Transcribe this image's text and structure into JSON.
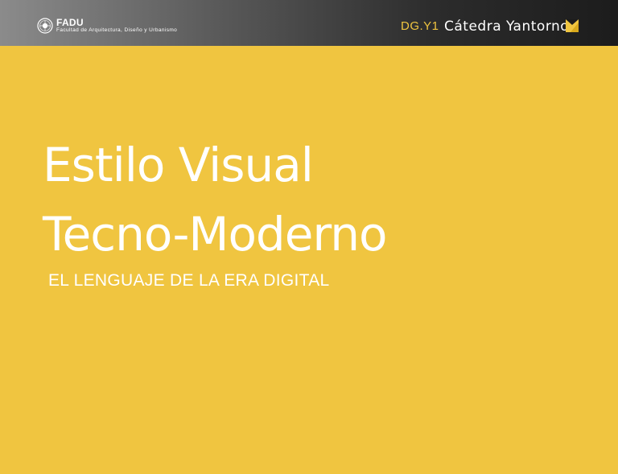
{
  "header": {
    "logo_icon": "university-seal-icon",
    "institution_short": "FADU",
    "institution_full": "Facultad de Arquitectura, Diseño y Urbanismo",
    "course_code": "DG.Y1",
    "chair_name": "Cátedra Yantorno",
    "chair_icon": "yantorno-mark-icon"
  },
  "cover": {
    "title_line_1": "Estilo Visual",
    "title_line_2": "Tecno-Moderno",
    "subtitle": "EL LENGUAJE DE LA ERA DIGITAL"
  },
  "colors": {
    "background": "#f0c540",
    "accent": "#f0c540",
    "text": "#ffffff",
    "header_dark": "#1c1c1c",
    "header_light": "#8b8b8b"
  }
}
